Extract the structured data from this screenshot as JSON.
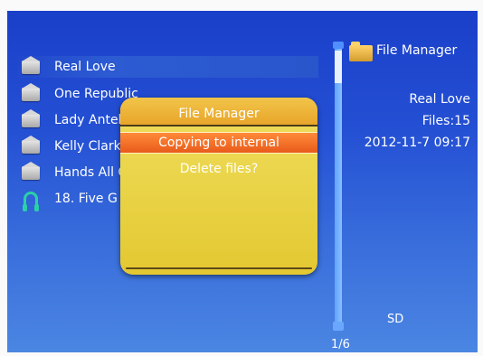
{
  "file_list": {
    "items": [
      {
        "label": "Real Love",
        "icon": "envelope-icon",
        "selected": true
      },
      {
        "label": "One Republic",
        "icon": "envelope-icon",
        "selected": false
      },
      {
        "label": "Lady Antel",
        "icon": "envelope-icon",
        "selected": false
      },
      {
        "label": "Kelly Clark",
        "icon": "envelope-icon",
        "selected": false
      },
      {
        "label": "Hands All C",
        "icon": "envelope-icon",
        "selected": false
      },
      {
        "label": "18. Five G",
        "icon": "headphone-icon",
        "selected": false
      }
    ]
  },
  "scrollbar": {
    "page": "1/6"
  },
  "right_panel": {
    "title": "File Manager",
    "selected_name": "Real Love",
    "files": "Files:15",
    "datetime": "2012-11-7 09:17",
    "storage": "SD"
  },
  "dialog": {
    "title": "File Manager",
    "options": [
      "Copying to internal",
      "Delete files?"
    ]
  },
  "colors": {
    "accent_orange": "#e85b1b",
    "dialog_bg": "#ead54a",
    "screen_blue": "#2450d4"
  }
}
